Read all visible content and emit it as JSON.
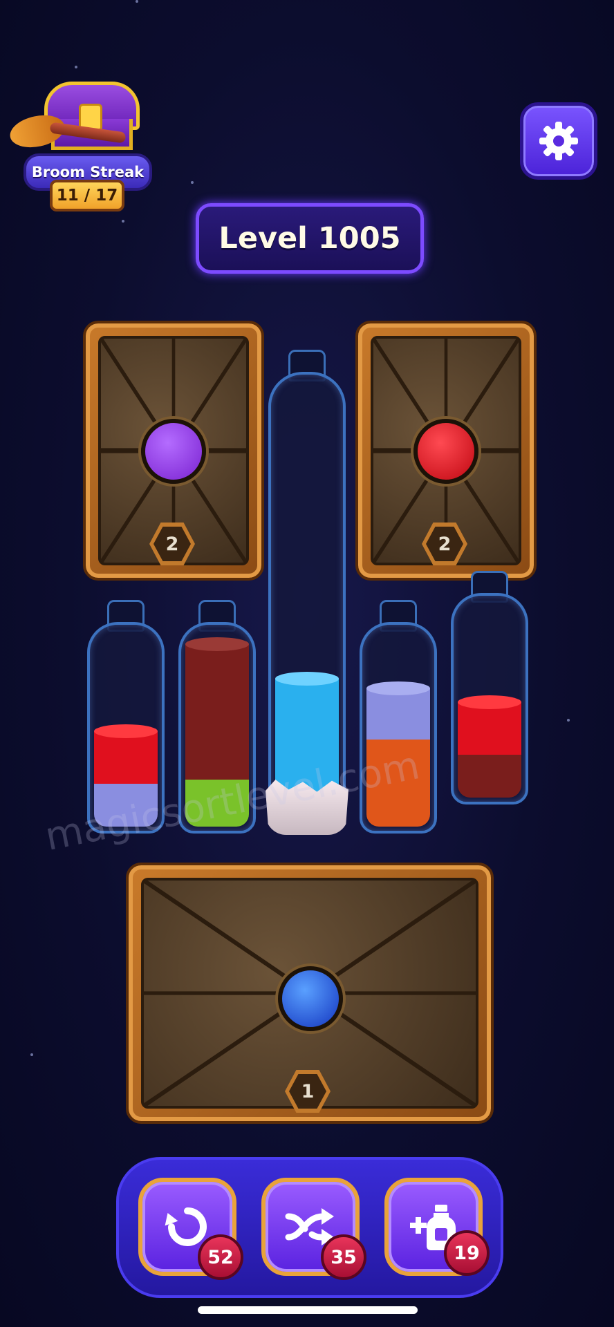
{
  "streak": {
    "title": "Broom Streak",
    "count": "11 / 17"
  },
  "settings": {
    "icon": "gear-icon"
  },
  "level": {
    "label": "Level 1005"
  },
  "crates": [
    {
      "id": "top-left",
      "lock_color": "#8a2be2",
      "number": "2"
    },
    {
      "id": "top-right",
      "lock_color": "#e0101e",
      "number": "2"
    },
    {
      "id": "bottom",
      "lock_color": "#2a5cff",
      "number": "1"
    }
  ],
  "bottles": [
    {
      "id": "bottle-1",
      "layers": [
        {
          "color": "#8a8ee0",
          "level": 0.22
        },
        {
          "color": "#e0101e",
          "level": 0.25
        }
      ]
    },
    {
      "id": "bottle-2",
      "layers": [
        {
          "color": "#7ac22a",
          "level": 0.22
        },
        {
          "color": "#7a1e1c",
          "level": 0.6
        }
      ]
    },
    {
      "id": "bottle-tall",
      "layers": [
        {
          "color": "#2ab0ee",
          "level": 0.32
        }
      ],
      "frozen": true
    },
    {
      "id": "bottle-4",
      "layers": [
        {
          "color": "#e0561a",
          "level": 0.4
        },
        {
          "color": "#8a8ee0",
          "level": 0.25
        }
      ]
    },
    {
      "id": "bottle-5",
      "layers": [
        {
          "color": "#7a1e1c",
          "level": 0.22
        },
        {
          "color": "#e0101e",
          "level": 0.25
        }
      ]
    }
  ],
  "powerups": [
    {
      "name": "undo",
      "icon": "undo-icon",
      "count": "52"
    },
    {
      "name": "shuffle",
      "icon": "shuffle-icon",
      "count": "35"
    },
    {
      "name": "add-bottle",
      "icon": "add-bottle-icon",
      "count": "19"
    }
  ],
  "watermark": "magicsortlevel.com"
}
